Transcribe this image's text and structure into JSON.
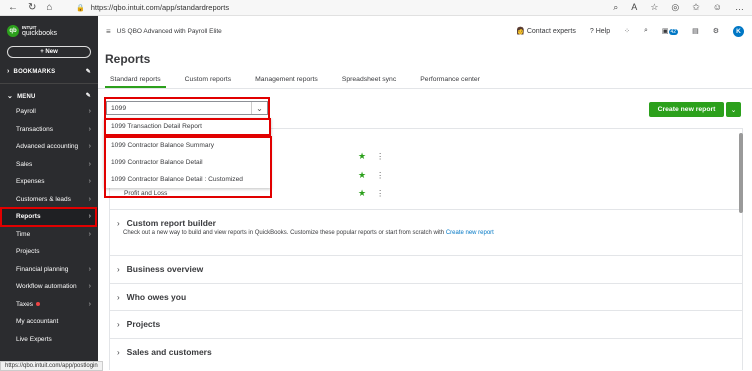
{
  "browser": {
    "url": "https://qbo.intuit.com/app/standardreports",
    "status_url": "https://qbo.intuit.com/app/postlogin"
  },
  "sidebar": {
    "logo_brand": "INTUIT",
    "logo_name": "quickbooks",
    "new_label": "+ New",
    "bookmarks_label": "BOOKMARKS",
    "menu_label": "MENU",
    "items": [
      {
        "label": "Payroll"
      },
      {
        "label": "Transactions"
      },
      {
        "label": "Advanced accounting"
      },
      {
        "label": "Sales"
      },
      {
        "label": "Expenses"
      },
      {
        "label": "Customers & leads"
      },
      {
        "label": "Reports"
      },
      {
        "label": "Time"
      },
      {
        "label": "Projects"
      },
      {
        "label": "Financial planning"
      },
      {
        "label": "Workflow automation"
      },
      {
        "label": "Taxes"
      },
      {
        "label": "My accountant"
      },
      {
        "label": "Live Experts"
      }
    ]
  },
  "topbar": {
    "company": "US QBO Advanced with Payroll Elite",
    "contact": "Contact experts",
    "help": "Help",
    "badge": "42",
    "avatar": "K"
  },
  "page": {
    "title": "Reports",
    "tabs": [
      "Standard reports",
      "Custom reports",
      "Management reports",
      "Spreadsheet sync",
      "Performance center"
    ],
    "search_value": "1099",
    "create_label": "Create new report"
  },
  "dropdown": [
    "1099 Transaction Detail Report",
    "1099 Contractor Balance Summary",
    "1099 Contractor Balance Detail",
    "1099 Contractor Balance Detail : Customized"
  ],
  "favorites_partial": "Profit and Loss",
  "sections": [
    {
      "title": "Custom report builder",
      "desc": "Check out a new way to build and view reports in QuickBooks. Customize these popular reports or start from scratch with",
      "link": "Create new report"
    },
    {
      "title": "Business overview"
    },
    {
      "title": "Who owes you"
    },
    {
      "title": "Projects"
    },
    {
      "title": "Sales and customers"
    }
  ],
  "colors": {
    "accent_green": "#2ca01c",
    "highlight_red": "#e10000",
    "link_blue": "#0077c5"
  }
}
